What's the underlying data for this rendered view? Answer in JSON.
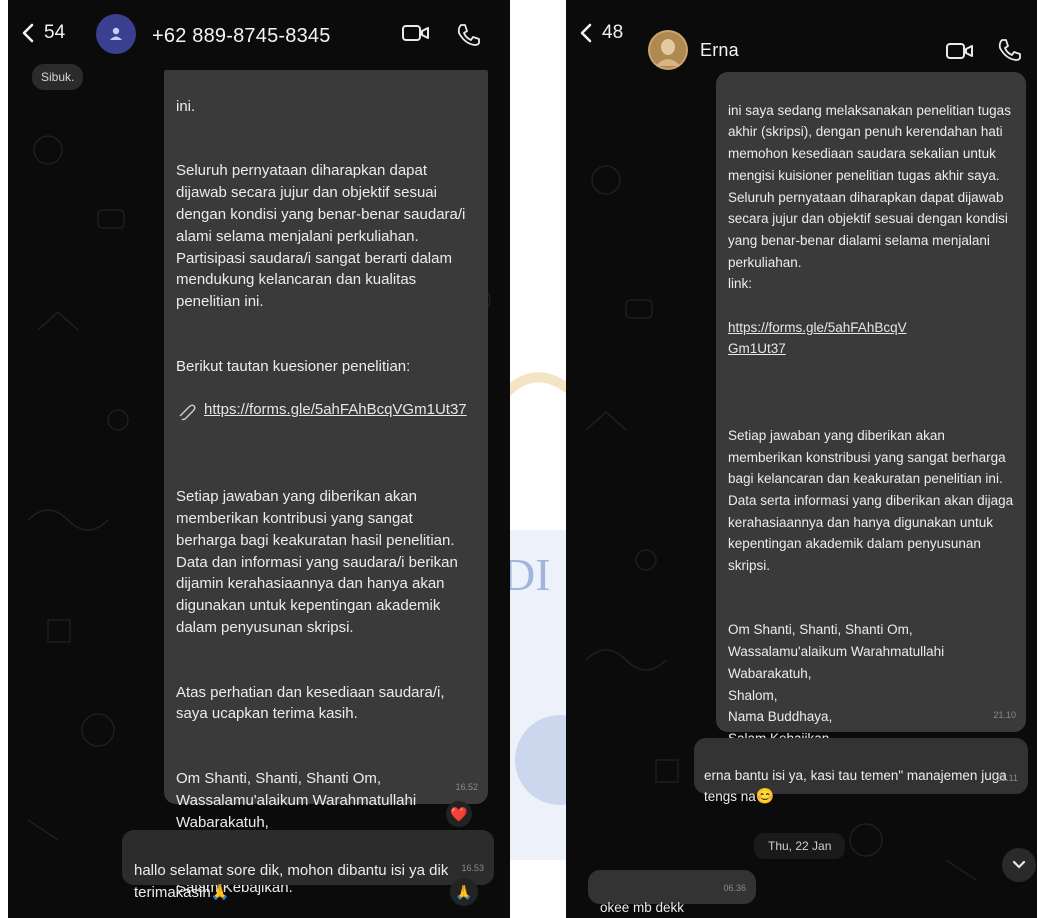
{
  "left_chat": {
    "back_count": "54",
    "contact_title": "+62 889-8745-8345",
    "status_chip": "Sibuk.",
    "message_cutoff": "ini.",
    "message_p1": "Seluruh pernyataan diharapkan dapat dijawab secara jujur dan objektif sesuai dengan kondisi yang benar-benar saudara/i alami selama menjalani perkuliahan. Partisipasi saudara/i sangat berarti dalam mendukung kelancaran dan kualitas penelitian ini.",
    "message_p2_label": "Berikut tautan kuesioner penelitian:",
    "message_link": "https://forms.gle/5ahFAhBcqVGm1Ut37",
    "message_p3": "Setiap jawaban yang diberikan akan memberikan kontribusi yang sangat berharga bagi keakuratan hasil penelitian. Data dan informasi yang saudara/i berikan dijamin kerahasiaannya dan hanya akan digunakan untuk kepentingan akademik dalam penyusunan skripsi.",
    "message_p4": "Atas perhatian dan kesediaan saudara/i, saya ucapkan terima kasih.",
    "message_p5": "Om Shanti, Shanti, Shanti Om,\nWassalamu'alaikum Warahmatullahi Wabarakatuh,\nShalom,\nNamo Buddhaya,\nSalam Kebajikan.",
    "message_time": "16.52",
    "reaction_emoji": "❤️",
    "reply_text": "hallo selamat sore dik, mohon dibantu isi ya dik terimakasih",
    "reply_emoji": "🙏",
    "reply_time": "16.53",
    "reply_reaction": "🙏"
  },
  "right_chat": {
    "back_count": "48",
    "contact_title": "Erna",
    "message_p1": "ini saya sedang melaksanakan penelitian tugas akhir (skripsi), dengan penuh kerendahan hati memohon kesediaan saudara sekalian untuk mengisi kuisioner penelitian tugas akhir saya. Seluruh pernyataan diharapkan dapat dijawab secara jujur dan objektif sesuai dengan kondisi yang benar-benar dialami selama menjalani perkuliahan.\nlink:",
    "message_link": "https://forms.gle/5ahFAhBcqVGm1Ut37",
    "message_p2": "Setiap jawaban yang diberikan akan memberikan konstribusi yang sangat berharga bagi kelancaran dan keakuratan penelitian ini. Data serta informasi yang diberikan akan dijaga kerahasiaannya dan hanya digunakan untuk kepentingan akademik dalam penyusunan skripsi.",
    "message_p3": "Om Shanti, Shanti, Shanti Om,\nWassalamu'alaikum Warahmatullahi Wabarakatuh,\nShalom,\nNama Buddhaya,\nSalam Kebajikan",
    "message_time": "21.10",
    "followup_text": "erna bantu isi ya, kasi tau temen\" manajemen juga tengs na",
    "followup_emoji": "😊",
    "followup_time": "21.11",
    "date_separator": "Thu, 22 Jan",
    "incoming_text": "okee mb dekk",
    "incoming_time": "06.36"
  },
  "colors": {
    "chat_bg": "#0b0b0b",
    "bubble_sent": "#3a3a3a",
    "bubble_reply": "#2c2c2c",
    "left_avatar": "#3b3f8f",
    "right_avatar": "#c9a56a"
  },
  "icons": [
    "back-chevron-icon",
    "person-icon",
    "video-call-icon",
    "phone-icon",
    "link-icon",
    "chevron-down-icon",
    "heart-icon",
    "pray-icon"
  ]
}
